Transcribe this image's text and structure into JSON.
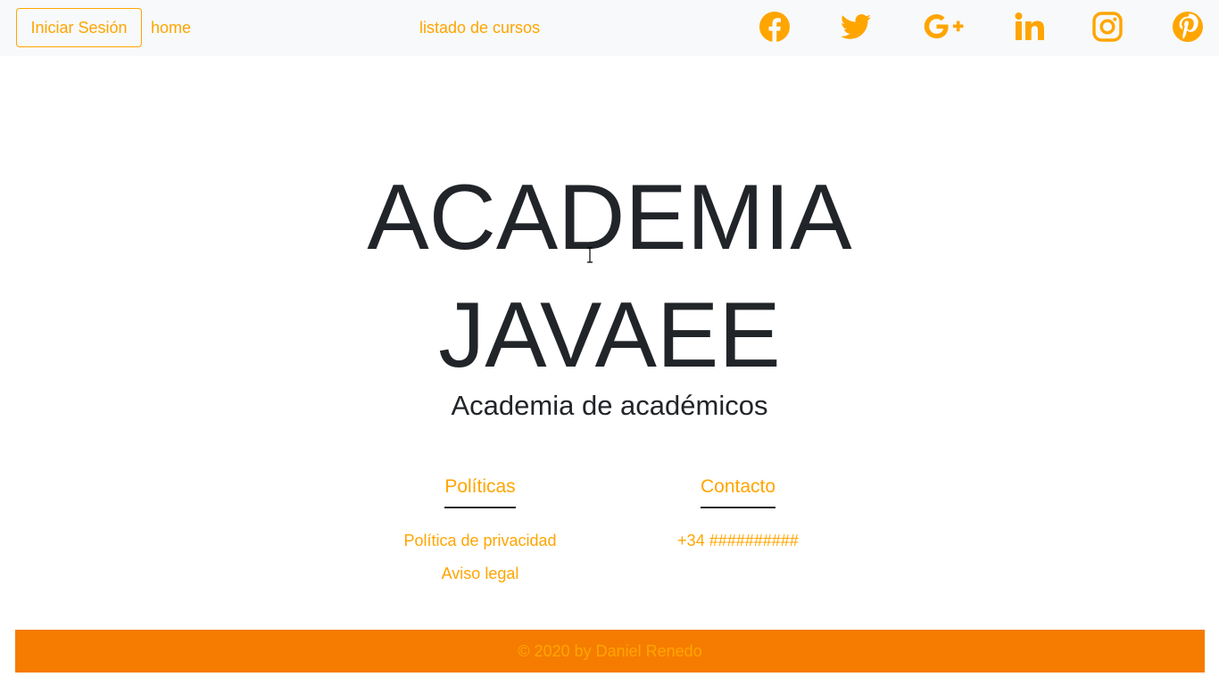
{
  "navbar": {
    "login_label": "Iniciar Sesión",
    "links": [
      {
        "label": "home"
      },
      {
        "label": "listado de cursos"
      }
    ],
    "social": [
      {
        "icon": "facebook-icon"
      },
      {
        "icon": "twitter-icon"
      },
      {
        "icon": "google-plus-icon"
      },
      {
        "icon": "linkedin-icon"
      },
      {
        "icon": "instagram-icon"
      },
      {
        "icon": "pinterest-icon"
      }
    ]
  },
  "hero": {
    "title_line1": "ACADEMIA",
    "title_line2": "JAVAEE",
    "subtitle": "Academia de académicos"
  },
  "policies": {
    "heading": "Políticas",
    "items": [
      {
        "label": "Política de privacidad"
      },
      {
        "label": "Aviso legal"
      }
    ]
  },
  "contact": {
    "heading": "Contacto",
    "items": [
      {
        "label": "+34 ##########"
      }
    ]
  },
  "footer": {
    "text": "© 2020 by Daniel Renedo"
  },
  "colors": {
    "accent": "#ffa500",
    "footer_bg": "#f57c00",
    "text": "#212529",
    "navbar_bg": "#f8f9fa"
  }
}
